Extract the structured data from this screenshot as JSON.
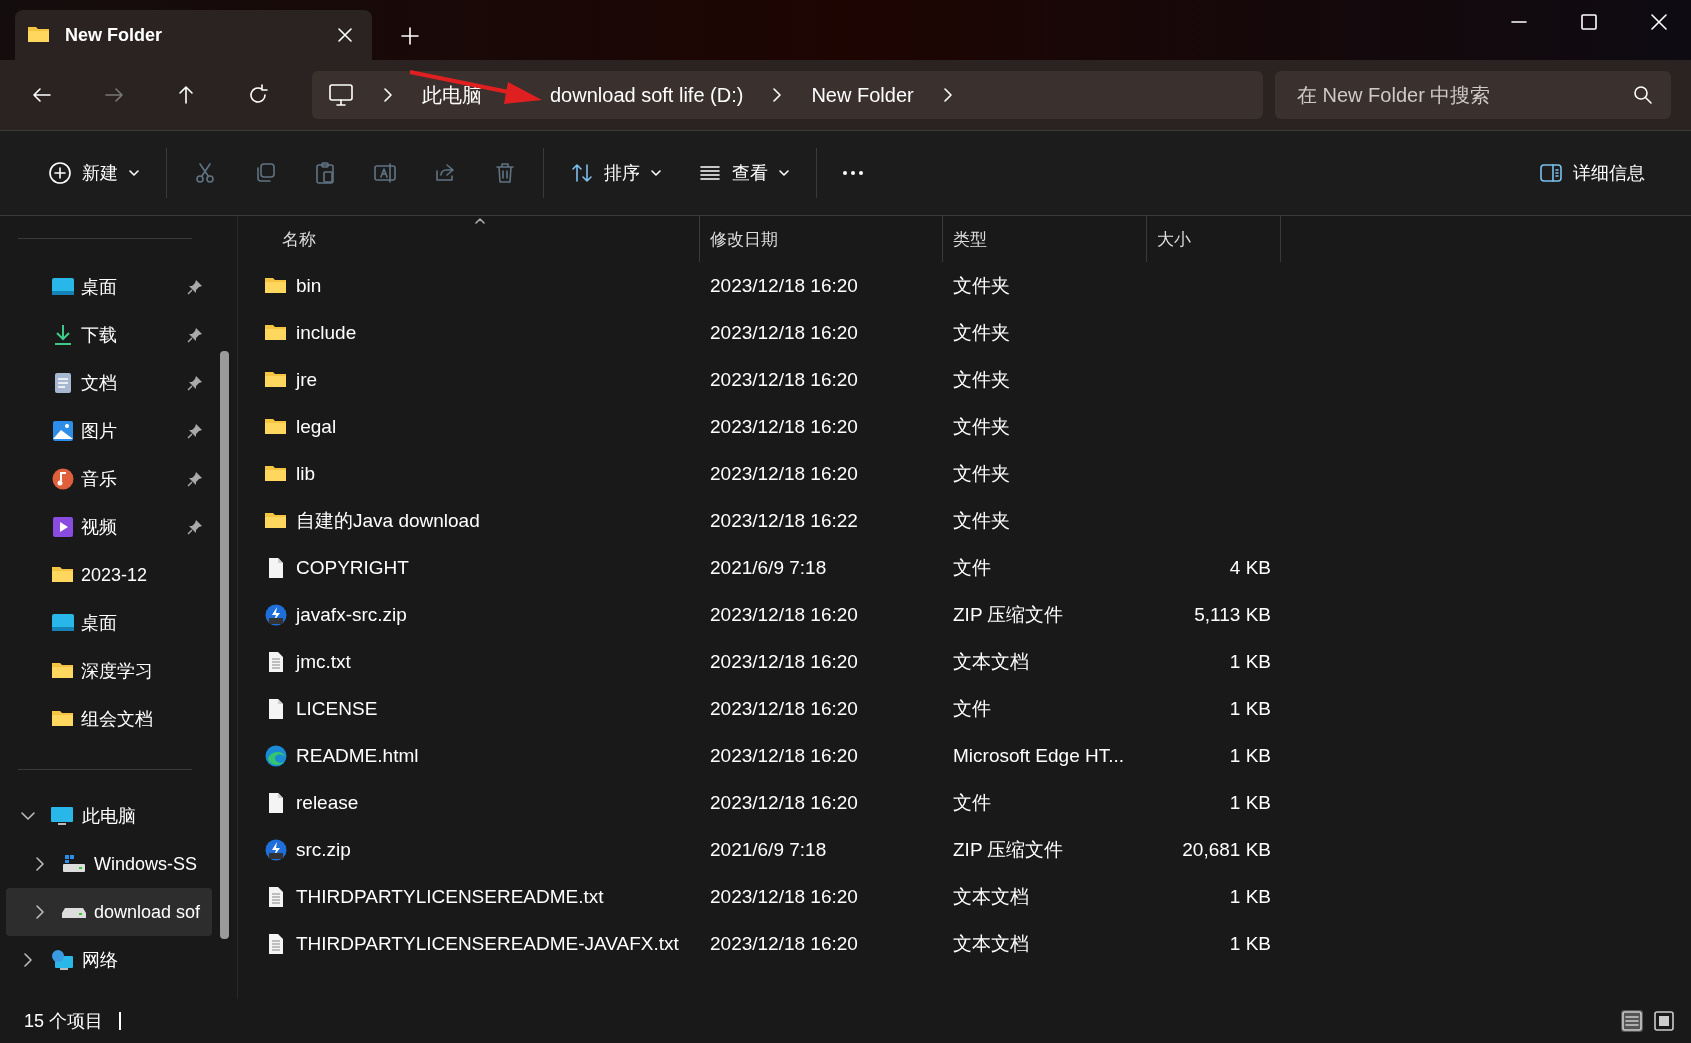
{
  "window": {
    "tab": {
      "title": "New Folder",
      "selected": true
    }
  },
  "nav_buttons": [
    {
      "kind": "back",
      "disabled": false
    },
    {
      "kind": "forward",
      "disabled": true
    },
    {
      "kind": "up",
      "disabled": false
    },
    {
      "kind": "refresh",
      "disabled": false
    }
  ],
  "breadcrumb": [
    "此电脑",
    "download soft life (D:)",
    "New Folder"
  ],
  "search": {
    "placeholder": "在 New Folder 中搜索"
  },
  "toolbar": {
    "groups": [
      [
        {
          "kind": "new",
          "label": "新建",
          "dropdown": true,
          "disabled": false
        }
      ],
      [
        {
          "kind": "cut",
          "disabled": true
        },
        {
          "kind": "copy",
          "disabled": true
        },
        {
          "kind": "paste",
          "disabled": true
        },
        {
          "kind": "rename",
          "disabled": true
        },
        {
          "kind": "share",
          "disabled": true
        },
        {
          "kind": "delete",
          "disabled": true
        }
      ],
      [
        {
          "kind": "sort",
          "label": "排序",
          "dropdown": true,
          "disabled": false
        },
        {
          "kind": "view",
          "label": "查看",
          "dropdown": true,
          "disabled": false
        }
      ],
      [
        {
          "kind": "more",
          "disabled": false
        }
      ]
    ],
    "details": {
      "label": "详细信息"
    }
  },
  "sidebar": {
    "quick_access": [
      {
        "label": "桌面",
        "kind": "desktop",
        "pinned": true
      },
      {
        "label": "下载",
        "kind": "download",
        "pinned": true
      },
      {
        "label": "文档",
        "kind": "document",
        "pinned": true
      },
      {
        "label": "图片",
        "kind": "pictures",
        "pinned": true
      },
      {
        "label": "音乐",
        "kind": "music",
        "pinned": true
      },
      {
        "label": "视频",
        "kind": "video",
        "pinned": true
      },
      {
        "label": "2023-12",
        "kind": "folder",
        "pinned": false
      },
      {
        "label": "桌面",
        "kind": "desktop",
        "pinned": false
      },
      {
        "label": "深度学习",
        "kind": "folder",
        "pinned": false
      },
      {
        "label": "组会文档",
        "kind": "folder",
        "pinned": false
      }
    ],
    "tree": [
      {
        "label": "此电脑",
        "kind": "pc",
        "expanded": true,
        "selected": false,
        "children": [
          {
            "label": "Windows-SS",
            "kind": "windrive",
            "expanded": false,
            "selected": false
          },
          {
            "label": "download sof",
            "kind": "drive",
            "expanded": false,
            "selected": true
          }
        ]
      },
      {
        "label": "网络",
        "kind": "network",
        "expanded": false,
        "selected": false
      }
    ]
  },
  "table": {
    "columns": [
      "名称",
      "修改日期",
      "类型",
      "大小"
    ],
    "rows": [
      {
        "kind": "folder",
        "name": "bin",
        "date": "2023/12/18 16:20",
        "type": "文件夹"
      },
      {
        "kind": "folder",
        "name": "include",
        "date": "2023/12/18 16:20",
        "type": "文件夹"
      },
      {
        "kind": "folder",
        "name": "jre",
        "date": "2023/12/18 16:20",
        "type": "文件夹"
      },
      {
        "kind": "folder",
        "name": "legal",
        "date": "2023/12/18 16:20",
        "type": "文件夹"
      },
      {
        "kind": "folder",
        "name": "lib",
        "date": "2023/12/18 16:20",
        "type": "文件夹"
      },
      {
        "kind": "folder",
        "name": "自建的Java download",
        "date": "2023/12/18 16:22",
        "type": "文件夹"
      },
      {
        "kind": "file",
        "name": "COPYRIGHT",
        "date": "2021/6/9 7:18",
        "type": "文件",
        "size": "4 KB"
      },
      {
        "kind": "zip",
        "name": "javafx-src.zip",
        "date": "2023/12/18 16:20",
        "type": "ZIP 压缩文件",
        "size": "5,113 KB"
      },
      {
        "kind": "text",
        "name": "jmc.txt",
        "date": "2023/12/18 16:20",
        "type": "文本文档",
        "size": "1 KB"
      },
      {
        "kind": "file",
        "name": "LICENSE",
        "date": "2023/12/18 16:20",
        "type": "文件",
        "size": "1 KB"
      },
      {
        "kind": "edge",
        "name": "README.html",
        "date": "2023/12/18 16:20",
        "type": "Microsoft Edge HT...",
        "size": "1 KB"
      },
      {
        "kind": "file",
        "name": "release",
        "date": "2023/12/18 16:20",
        "type": "文件",
        "size": "1 KB"
      },
      {
        "kind": "zip",
        "name": "src.zip",
        "date": "2021/6/9 7:18",
        "type": "ZIP 压缩文件",
        "size": "20,681 KB"
      },
      {
        "kind": "text",
        "name": "THIRDPARTYLICENSEREADME.txt",
        "date": "2023/12/18 16:20",
        "type": "文本文档",
        "size": "1 KB"
      },
      {
        "kind": "text",
        "name": "THIRDPARTYLICENSEREADME-JAVAFX.txt",
        "date": "2023/12/18 16:20",
        "type": "文本文档",
        "size": "1 KB"
      }
    ]
  },
  "status_bar": {
    "count": "15 个项目",
    "views": [
      {
        "kind": "details",
        "selected": true
      },
      {
        "kind": "tiles",
        "selected": false
      }
    ]
  }
}
